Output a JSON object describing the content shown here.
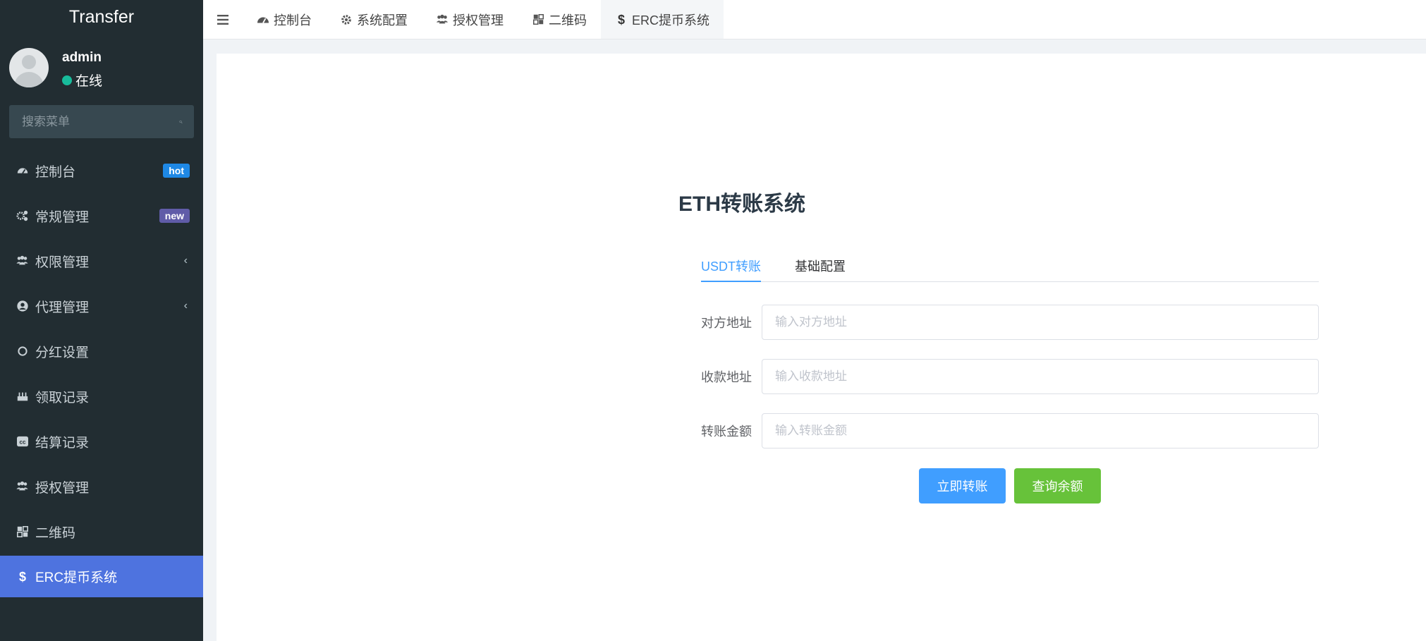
{
  "app": {
    "title": "Transfer"
  },
  "user": {
    "name": "admin",
    "status": "在线"
  },
  "search": {
    "placeholder": "搜索菜单"
  },
  "sidebar": {
    "items": [
      {
        "label": "控制台",
        "icon": "dashboard-icon",
        "badge": "hot"
      },
      {
        "label": "常规管理",
        "icon": "cogs-icon",
        "badge": "new"
      },
      {
        "label": "权限管理",
        "icon": "users-icon",
        "chevron": "‹"
      },
      {
        "label": "代理管理",
        "icon": "user-circle-icon",
        "chevron": "‹"
      },
      {
        "label": "分红设置",
        "icon": "circle-icon"
      },
      {
        "label": "领取记录",
        "icon": "birthday-cake-icon"
      },
      {
        "label": "结算记录",
        "icon": "cc-icon"
      },
      {
        "label": "授权管理",
        "icon": "users-icon"
      },
      {
        "label": "二维码",
        "icon": "qrcode-icon"
      },
      {
        "label": "ERC提币系统",
        "icon": "dollar-icon",
        "active": true
      }
    ]
  },
  "topnav": {
    "tabs": [
      {
        "label": "控制台",
        "icon": "dashboard-icon"
      },
      {
        "label": "系统配置",
        "icon": "gear-icon"
      },
      {
        "label": "授权管理",
        "icon": "users-icon"
      },
      {
        "label": "二维码",
        "icon": "qrcode-icon"
      },
      {
        "label": "ERC提币系统",
        "icon": "dollar-icon",
        "active": true
      }
    ]
  },
  "form": {
    "title": "ETH转账系统",
    "tabs": [
      {
        "label": "USDT转账",
        "active": true
      },
      {
        "label": "基础配置"
      }
    ],
    "fields": [
      {
        "label": "对方地址",
        "placeholder": "输入对方地址",
        "value": ""
      },
      {
        "label": "收款地址",
        "placeholder": "输入收款地址",
        "value": ""
      },
      {
        "label": "转账金额",
        "placeholder": "输入转账金额",
        "value": ""
      }
    ],
    "buttons": {
      "transfer": "立即转账",
      "query": "查询余额"
    }
  },
  "colors": {
    "sidebar_bg": "#222d32",
    "sidebar_active": "#4e73df",
    "primary": "#409eff",
    "success": "#67c23a",
    "online": "#18bc9c"
  }
}
